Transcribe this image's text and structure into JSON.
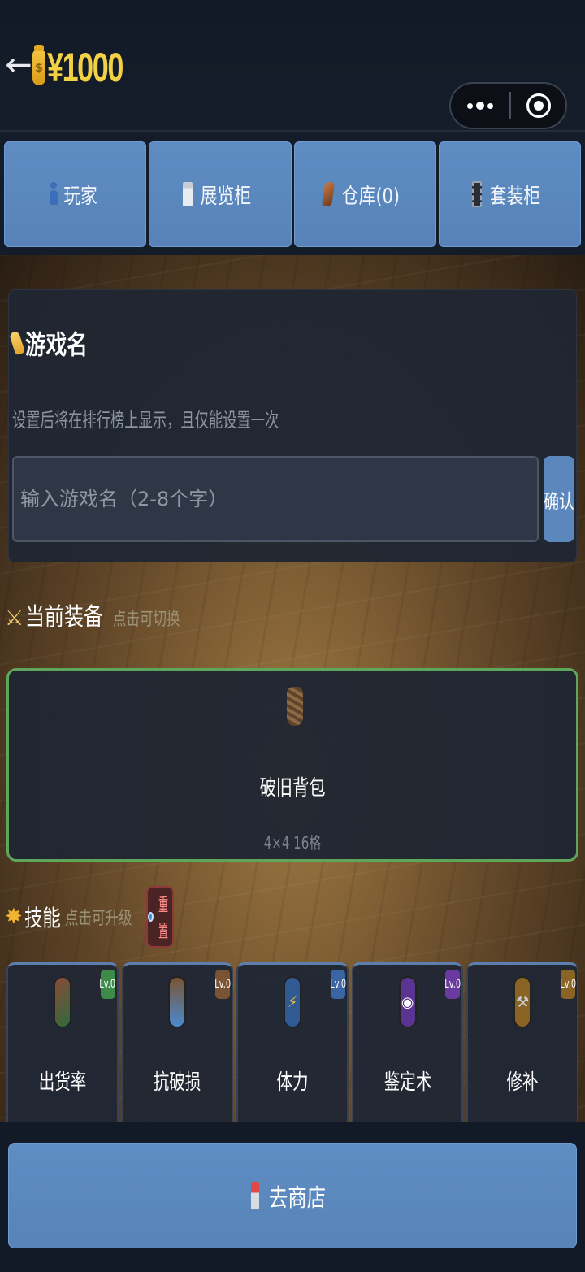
{
  "header": {
    "back_icon": "arrow-left-icon",
    "money_icon": "money-bag-icon",
    "money": "¥1000"
  },
  "tabs": [
    {
      "icon": "person-icon",
      "label": "玩家"
    },
    {
      "icon": "bank-icon",
      "label": "展览柜"
    },
    {
      "icon": "gem-icon",
      "label": "仓库(0)"
    },
    {
      "icon": "film-icon",
      "label": "套装柜"
    }
  ],
  "name_card": {
    "title": "游戏名",
    "hint": "设置后将在排行榜上显示，且仅能设置一次",
    "input_placeholder": "输入游戏名（2-8个字）",
    "input_value": "",
    "confirm_label": "确认"
  },
  "equipment": {
    "heading": "当前装备",
    "sub": "点击可切换",
    "item_name": "破旧背包",
    "item_size": "4×4 16格",
    "border_color": "#5da65a"
  },
  "skills": {
    "heading": "技能",
    "sub": "点击可升级",
    "reset_label": "重置",
    "items": [
      {
        "name": "出货率",
        "level": "Lv.0",
        "icon": "card-icon",
        "badge_color": "#3e8a4a",
        "icon_color": "#2f6b3c"
      },
      {
        "name": "抗破损",
        "level": "Lv.0",
        "icon": "shield-icon",
        "badge_color": "#7a5432",
        "icon_color": "#7a5432"
      },
      {
        "name": "体力",
        "level": "Lv.0",
        "icon": "lightning-icon",
        "badge_color": "#3a64a2",
        "icon_color": "#2f5a94"
      },
      {
        "name": "鉴定术",
        "level": "Lv.0",
        "icon": "magnifier-icon",
        "badge_color": "#6a3aa0",
        "icon_color": "#5b3390"
      },
      {
        "name": "修补",
        "level": "Lv.0",
        "icon": "wrench-icon",
        "badge_color": "#8a6424",
        "icon_color": "#8a6424"
      }
    ]
  },
  "bottom": {
    "shop_label": "去商店"
  }
}
